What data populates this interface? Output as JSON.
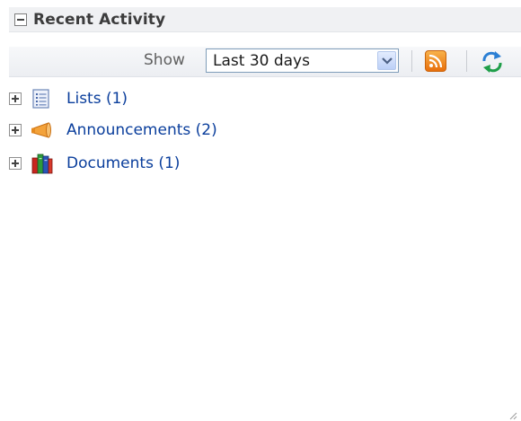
{
  "panel": {
    "title": "Recent Activity"
  },
  "toolbar": {
    "show_label": "Show",
    "range_select": {
      "selected": "Last 30 days"
    }
  },
  "tree": {
    "items": [
      {
        "label": "Lists (1)",
        "icon": "list-icon"
      },
      {
        "label": "Announcements (2)",
        "icon": "megaphone-icon"
      },
      {
        "label": "Documents (1)",
        "icon": "books-icon"
      }
    ]
  },
  "colors": {
    "header_bg": "#f0f1f3",
    "link": "#0a3e9c",
    "rss": "#f08a1c"
  }
}
